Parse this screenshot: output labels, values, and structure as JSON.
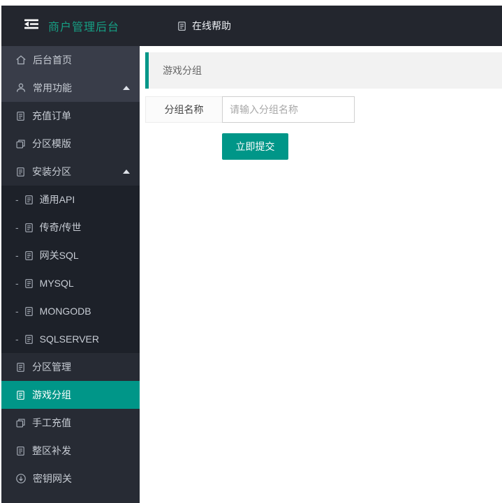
{
  "colors": {
    "accent_teal": "#009688",
    "brand_text_teal": "#16a085",
    "header_bg": "#23262e",
    "sidebar_level0_bg": "#393d49",
    "sidebar_level1_bg": "#272b34",
    "sidebar_level2_bg": "#1d2129",
    "panel_header_bg": "#f2f2f2"
  },
  "header": {
    "title": "商户管理后台",
    "help_label": "在线帮助"
  },
  "sidebar": {
    "items": [
      {
        "name": "home",
        "label": "后台首页",
        "icon": "home",
        "level": 0
      },
      {
        "name": "common-functions",
        "label": "常用功能",
        "icon": "user",
        "level": 0,
        "expanded": true
      },
      {
        "name": "recharge-orders",
        "label": "充值订单",
        "icon": "doc",
        "level": 1
      },
      {
        "name": "partition-template",
        "label": "分区模版",
        "icon": "copy",
        "level": 1
      },
      {
        "name": "install-partition",
        "label": "安装分区",
        "icon": "doc",
        "level": 1,
        "expanded": true
      },
      {
        "name": "generic-api",
        "label": "通用API",
        "icon": "doc",
        "level": 2
      },
      {
        "name": "chuanqi-chuanshi",
        "label": "传奇/传世",
        "icon": "doc",
        "level": 2
      },
      {
        "name": "gateway-sql",
        "label": "网关SQL",
        "icon": "doc",
        "level": 2
      },
      {
        "name": "mysql",
        "label": "MYSQL",
        "icon": "doc",
        "level": 2
      },
      {
        "name": "mongodb",
        "label": "MONGODB",
        "icon": "doc",
        "level": 2
      },
      {
        "name": "sqlserver",
        "label": "SQLSERVER",
        "icon": "doc",
        "level": 2
      },
      {
        "name": "partition-management",
        "label": "分区管理",
        "icon": "doc",
        "level": 1
      },
      {
        "name": "game-group",
        "label": "游戏分组",
        "icon": "doc",
        "level": 1,
        "active": true
      },
      {
        "name": "manual-recharge",
        "label": "手工充值",
        "icon": "copy",
        "level": 1
      },
      {
        "name": "zone-reissue",
        "label": "整区补发",
        "icon": "doc",
        "level": 1
      },
      {
        "name": "key-gateway",
        "label": "密钥网关",
        "icon": "circle-down",
        "level": 1
      }
    ]
  },
  "panel": {
    "title": "游戏分组"
  },
  "form": {
    "group_name_label": "分组名称",
    "group_name_placeholder": "请输入分组名称",
    "submit_label": "立即提交"
  }
}
